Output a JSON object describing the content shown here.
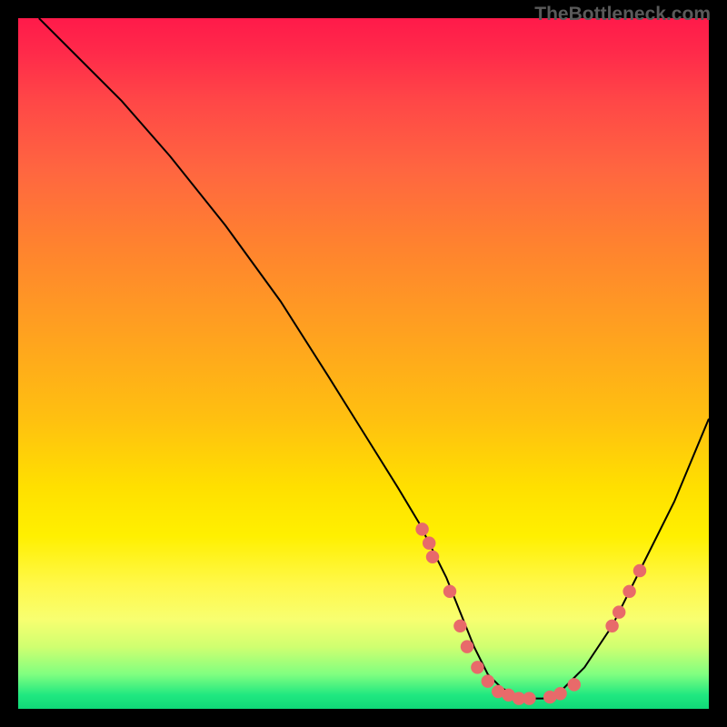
{
  "watermark": "TheBottleneck.com",
  "chart_data": {
    "type": "line",
    "title": "",
    "xlabel": "",
    "ylabel": "",
    "xlim": [
      0,
      100
    ],
    "ylim": [
      0,
      100
    ],
    "series": [
      {
        "name": "curve",
        "x": [
          3,
          8,
          15,
          22,
          30,
          38,
          45,
          50,
          55,
          58,
          60,
          62,
          64,
          66,
          68,
          70,
          72,
          74,
          76,
          78,
          82,
          86,
          90,
          95,
          100
        ],
        "y": [
          100,
          95,
          88,
          80,
          70,
          59,
          48,
          40,
          32,
          27,
          23,
          19,
          14,
          9,
          5,
          3,
          2,
          1.5,
          1.5,
          2,
          6,
          12,
          20,
          30,
          42
        ]
      }
    ],
    "markers": [
      {
        "x": 58.5,
        "y": 26
      },
      {
        "x": 59.5,
        "y": 24
      },
      {
        "x": 60.0,
        "y": 22
      },
      {
        "x": 62.5,
        "y": 17
      },
      {
        "x": 64.0,
        "y": 12
      },
      {
        "x": 65.0,
        "y": 9
      },
      {
        "x": 66.5,
        "y": 6
      },
      {
        "x": 68.0,
        "y": 4
      },
      {
        "x": 69.5,
        "y": 2.5
      },
      {
        "x": 71.0,
        "y": 2
      },
      {
        "x": 72.5,
        "y": 1.5
      },
      {
        "x": 74.0,
        "y": 1.5
      },
      {
        "x": 77.0,
        "y": 1.7
      },
      {
        "x": 78.5,
        "y": 2.2
      },
      {
        "x": 80.5,
        "y": 3.5
      },
      {
        "x": 86.0,
        "y": 12
      },
      {
        "x": 87.0,
        "y": 14
      },
      {
        "x": 88.5,
        "y": 17
      },
      {
        "x": 90.0,
        "y": 20
      }
    ],
    "gradient_stops": [
      {
        "pos": 0,
        "color": "#ff1a4a"
      },
      {
        "pos": 5,
        "color": "#ff2a4a"
      },
      {
        "pos": 12,
        "color": "#ff4747"
      },
      {
        "pos": 22,
        "color": "#ff6640"
      },
      {
        "pos": 32,
        "color": "#ff8030"
      },
      {
        "pos": 45,
        "color": "#ffa020"
      },
      {
        "pos": 58,
        "color": "#ffc010"
      },
      {
        "pos": 68,
        "color": "#ffe000"
      },
      {
        "pos": 75,
        "color": "#fff000"
      },
      {
        "pos": 82,
        "color": "#fff84a"
      },
      {
        "pos": 87,
        "color": "#f8ff70"
      },
      {
        "pos": 91,
        "color": "#d0ff70"
      },
      {
        "pos": 95,
        "color": "#80ff80"
      },
      {
        "pos": 98,
        "color": "#20e880"
      },
      {
        "pos": 100,
        "color": "#10d878"
      }
    ],
    "marker_color": "#e86a6a",
    "curve_color": "#000000"
  }
}
